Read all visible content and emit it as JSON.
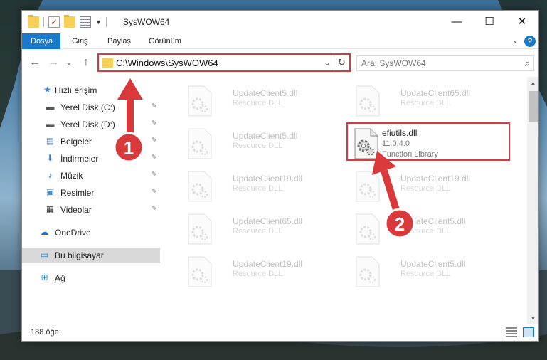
{
  "window": {
    "title": "SysWOW64",
    "minimize_glyph": "—",
    "maximize_glyph": "☐",
    "close_glyph": "✕"
  },
  "ribbon": {
    "tabs": [
      {
        "label": "Dosya",
        "active": true
      },
      {
        "label": "Giriş"
      },
      {
        "label": "Paylaş"
      },
      {
        "label": "Görünüm"
      }
    ],
    "help": "?",
    "expand": "⌄"
  },
  "address": {
    "back": "←",
    "forward": "→",
    "recent": "⌄",
    "up": "↑",
    "path": "C:\\Windows\\SysWOW64",
    "chevron": "⌄",
    "refresh": "↻"
  },
  "search": {
    "placeholder": "Ara: SysWOW64",
    "icon": "search-icon"
  },
  "sidebar": {
    "items": [
      {
        "label": "Hızlı erişim",
        "icon": "star-icon",
        "glyph": "★",
        "color": "#2a7fd4"
      },
      {
        "label": "Yerel Disk (C:)",
        "icon": "drive-icon",
        "glyph": "▬",
        "color": "#555555",
        "pinned": true
      },
      {
        "label": "Yerel Disk (D:)",
        "icon": "drive-icon",
        "glyph": "▬",
        "color": "#555555",
        "pinned": true
      },
      {
        "label": "Belgeler",
        "icon": "documents-icon",
        "glyph": "▤",
        "color": "#6b8fb5",
        "pinned": true
      },
      {
        "label": "İndirmeler",
        "icon": "download-icon",
        "glyph": "⬇",
        "color": "#2a7fd4",
        "pinned": true
      },
      {
        "label": "Müzik",
        "icon": "music-icon",
        "glyph": "♪",
        "color": "#2a7fd4",
        "pinned": true
      },
      {
        "label": "Resimler",
        "icon": "pictures-icon",
        "glyph": "▣",
        "color": "#4f87b8",
        "pinned": true
      },
      {
        "label": "Videolar",
        "icon": "video-icon",
        "glyph": "▦",
        "color": "#333333",
        "pinned": true
      },
      {
        "label": "OneDrive",
        "icon": "cloud-icon",
        "glyph": "☁",
        "color": "#1f6fc4"
      },
      {
        "label": "Bu bilgisayar",
        "icon": "computer-icon",
        "glyph": "▭",
        "color": "#2a7fd4",
        "selected": true
      },
      {
        "label": "Ağ",
        "icon": "network-icon",
        "glyph": "⊞",
        "color": "#2a7fd4"
      }
    ],
    "pin_glyph": "📌"
  },
  "files": [
    {
      "name": "UpdateClient5.dll",
      "meta1": "Resource DLL",
      "meta2": "",
      "faded": true
    },
    {
      "name": "UpdateClient65.dll",
      "meta1": "Resource DLL",
      "meta2": "",
      "faded": true
    },
    {
      "name": "UpdateClient5.dll",
      "meta1": "Resource DLL",
      "meta2": "",
      "faded": true
    },
    {
      "name": "efiutils.dll",
      "meta1": "11.0.4.0",
      "meta2": "Function Library",
      "faded": false,
      "highlight": true
    },
    {
      "name": "UpdateClient19.dll",
      "meta1": "Resource DLL",
      "meta2": "",
      "faded": true
    },
    {
      "name": "UpdateClient19.dll",
      "meta1": "Resource DLL",
      "meta2": "",
      "faded": true
    },
    {
      "name": "UpdateClient65.dll",
      "meta1": "Resource DLL",
      "meta2": "",
      "faded": true
    },
    {
      "name": "UpdateClient5.dll",
      "meta1": "Resource DLL",
      "meta2": "",
      "faded": true
    },
    {
      "name": "UpdateClient19.dll",
      "meta1": "Resource DLL",
      "meta2": "",
      "faded": true
    },
    {
      "name": "UpdateClient5.dll",
      "meta1": "Resource DLL",
      "meta2": "",
      "faded": true
    }
  ],
  "status": {
    "count": "188 öğe"
  },
  "annotations": {
    "step1": "1",
    "step2": "2",
    "color": "#d9393a"
  }
}
